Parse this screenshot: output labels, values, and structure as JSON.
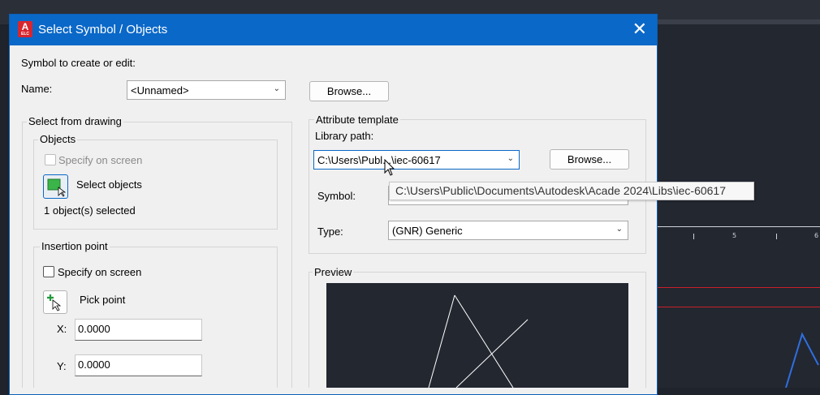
{
  "dialog": {
    "title": "Select Symbol / Objects",
    "app_icon_letter": "A",
    "app_icon_sub": "ELC",
    "close_glyph": "✕"
  },
  "symbol_section": {
    "heading": "Symbol to create or edit:",
    "name_label": "Name:",
    "name_value": "<Unnamed>",
    "browse_label": "Browse..."
  },
  "select_from_drawing": {
    "title": "Select from drawing",
    "objects": {
      "title": "Objects",
      "specify_on_screen": "Specify on screen",
      "select_objects": "Select objects",
      "status": "1 object(s) selected"
    },
    "insertion_point": {
      "title": "Insertion point",
      "specify_on_screen": "Specify on screen",
      "pick_point": "Pick point",
      "x_label": "X:",
      "x_value": "0.0000",
      "y_label": "Y:",
      "y_value": "0.0000"
    }
  },
  "attribute_template": {
    "title": "Attribute template",
    "library_path_label": "Library path:",
    "library_path_value": "C:\\Users\\Publ...\\iec-60617",
    "browse_label": "Browse...",
    "symbol_label": "Symbol:",
    "type_label": "Type:",
    "type_value": "(GNR) Generic"
  },
  "tooltip": {
    "text": "C:\\Users\\Public\\Documents\\Autodesk\\Acade 2024\\Libs\\iec-60617"
  },
  "preview": {
    "title": "Preview"
  },
  "background": {
    "tick_labels": [
      "5",
      "6"
    ]
  },
  "colors": {
    "titlebar": "#0a68c8",
    "dialog_bg": "#f0f0f0",
    "canvas_bg": "#232730",
    "red_line": "#c8202a",
    "blue_line": "#2f6fe0"
  },
  "icons": {
    "select_objects": "select-objects-icon",
    "pick_point": "pick-point-icon",
    "cursor": "mouse-cursor-icon"
  }
}
